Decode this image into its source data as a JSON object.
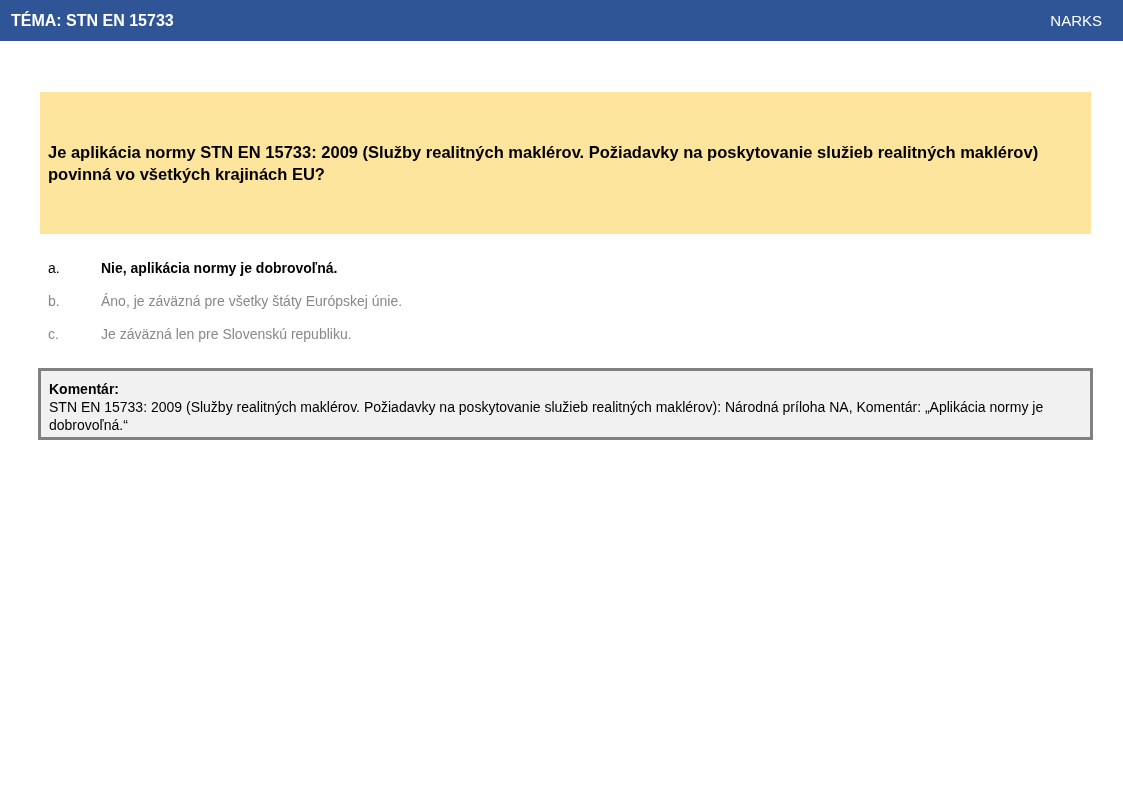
{
  "header": {
    "topic": "TÉMA: STN EN 15733",
    "brand": "NARKS"
  },
  "question": "Je aplikácia normy STN EN 15733: 2009 (Služby realitných maklérov. Požiadavky na poskytovanie služieb realitných maklérov) povinná vo všetkých krajinách EU?",
  "answers": [
    {
      "letter": "a.",
      "text": "Nie, aplikácia normy je dobrovoľná.",
      "correct": true
    },
    {
      "letter": "b.",
      "text": "Áno, je záväzná pre všetky štáty Európskej únie.",
      "correct": false
    },
    {
      "letter": "c.",
      "text": "Je záväzná len pre Slovenskú republiku.",
      "correct": false
    }
  ],
  "comment": {
    "title": "Komentár:",
    "text": "STN EN 15733: 2009 (Služby realitných maklérov. Požiadavky na poskytovanie služieb realitných maklérov): Národná príloha NA, Komentár: „Aplikácia normy je dobrovoľná.“"
  }
}
